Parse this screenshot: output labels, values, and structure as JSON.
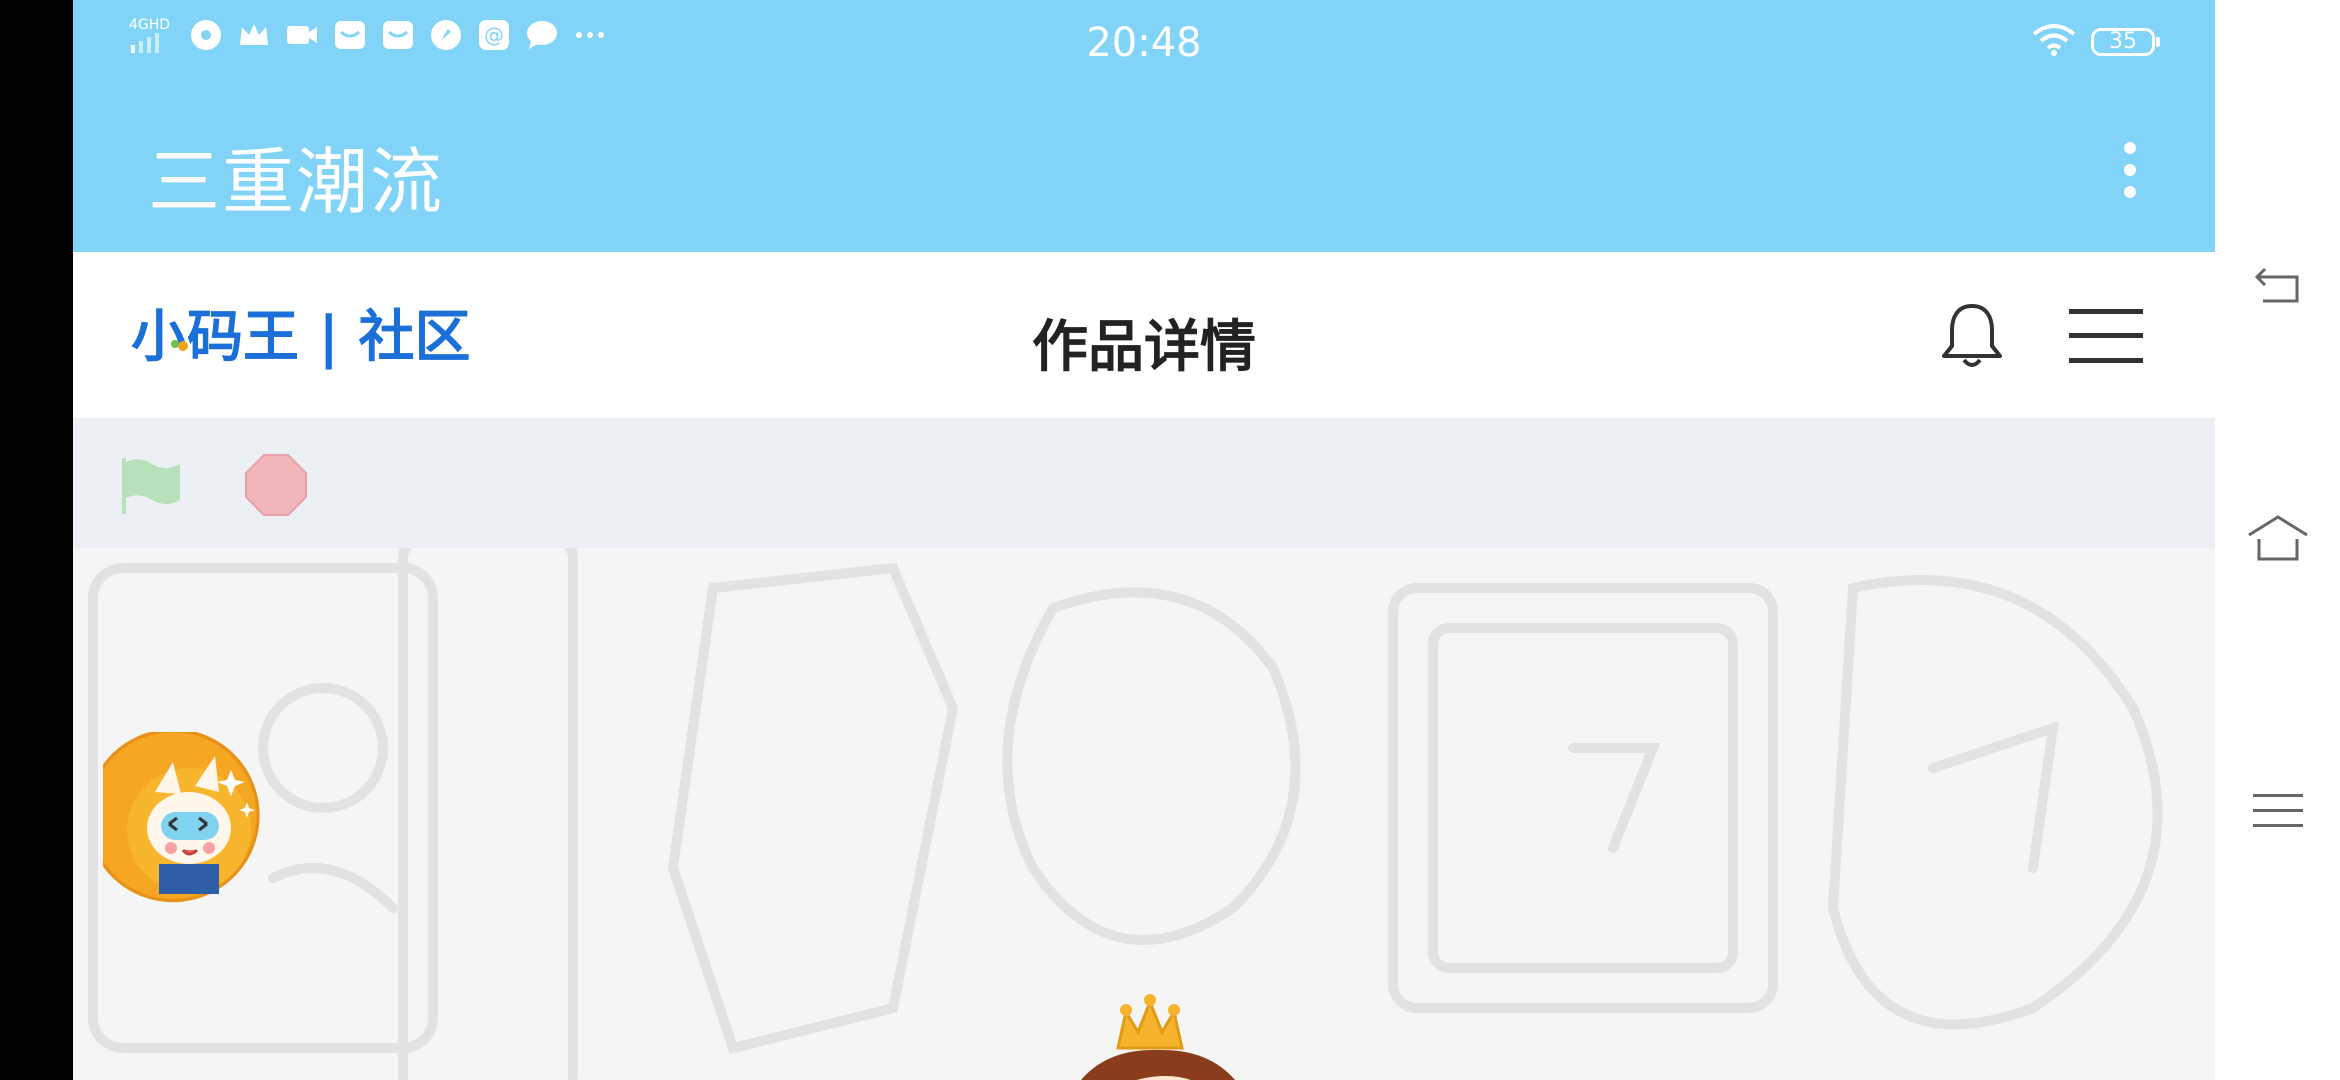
{
  "status_bar": {
    "network": "4GHD",
    "time": "20:48",
    "battery": "35",
    "notification_icons": [
      "chat-bubble-icon",
      "crown-icon",
      "video-icon",
      "mail-icon",
      "mail-icon",
      "compass-icon",
      "at-icon",
      "message-icon",
      "more-dots-icon"
    ]
  },
  "app_bar": {
    "title": "三重潮流"
  },
  "header": {
    "logo_text": "小码王 | 社区",
    "page_title": "作品详情"
  },
  "colors": {
    "app_bar": "#81d4f7",
    "logo_blue": "#1a6fd8",
    "control_bg": "#eceff4",
    "flag_green": "#b8e1bb",
    "stop_red": "#f2b6bd"
  }
}
